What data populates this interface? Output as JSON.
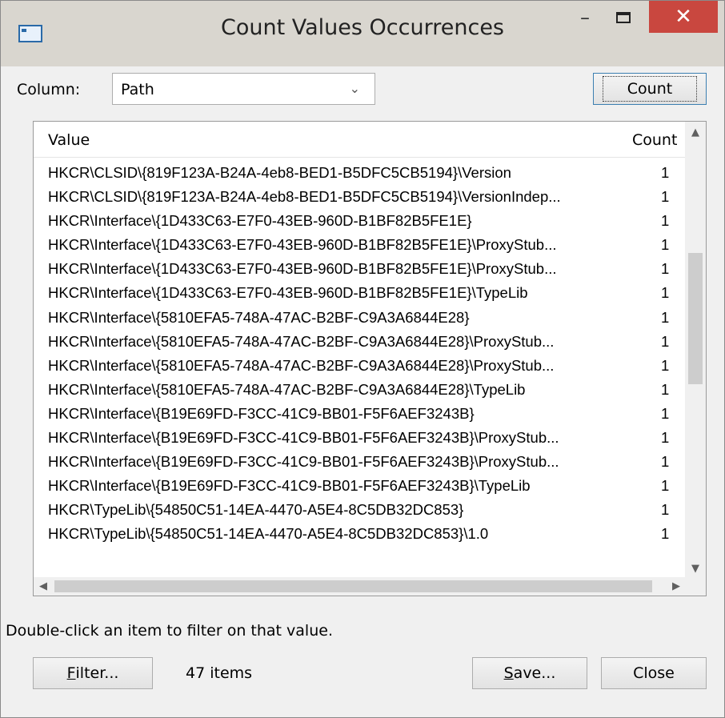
{
  "window": {
    "title": "Count Values Occurrences",
    "minimize_glyph": "–",
    "close_glyph": "✕"
  },
  "column": {
    "label": "Column:",
    "selected": "Path",
    "arrow": "⌄"
  },
  "count_button": "Count",
  "list": {
    "headers": {
      "value": "Value",
      "count": "Count"
    },
    "rows": [
      {
        "value": "HKCR\\CLSID\\{819F123A-B24A-4eb8-BED1-B5DFC5CB5194}\\Version",
        "count": "1"
      },
      {
        "value": "HKCR\\CLSID\\{819F123A-B24A-4eb8-BED1-B5DFC5CB5194}\\VersionIndep...",
        "count": "1"
      },
      {
        "value": "HKCR\\Interface\\{1D433C63-E7F0-43EB-960D-B1BF82B5FE1E}",
        "count": "1"
      },
      {
        "value": "HKCR\\Interface\\{1D433C63-E7F0-43EB-960D-B1BF82B5FE1E}\\ProxyStub...",
        "count": "1"
      },
      {
        "value": "HKCR\\Interface\\{1D433C63-E7F0-43EB-960D-B1BF82B5FE1E}\\ProxyStub...",
        "count": "1"
      },
      {
        "value": "HKCR\\Interface\\{1D433C63-E7F0-43EB-960D-B1BF82B5FE1E}\\TypeLib",
        "count": "1"
      },
      {
        "value": "HKCR\\Interface\\{5810EFA5-748A-47AC-B2BF-C9A3A6844E28}",
        "count": "1"
      },
      {
        "value": "HKCR\\Interface\\{5810EFA5-748A-47AC-B2BF-C9A3A6844E28}\\ProxyStub...",
        "count": "1"
      },
      {
        "value": "HKCR\\Interface\\{5810EFA5-748A-47AC-B2BF-C9A3A6844E28}\\ProxyStub...",
        "count": "1"
      },
      {
        "value": "HKCR\\Interface\\{5810EFA5-748A-47AC-B2BF-C9A3A6844E28}\\TypeLib",
        "count": "1"
      },
      {
        "value": "HKCR\\Interface\\{B19E69FD-F3CC-41C9-BB01-F5F6AEF3243B}",
        "count": "1"
      },
      {
        "value": "HKCR\\Interface\\{B19E69FD-F3CC-41C9-BB01-F5F6AEF3243B}\\ProxyStub...",
        "count": "1"
      },
      {
        "value": "HKCR\\Interface\\{B19E69FD-F3CC-41C9-BB01-F5F6AEF3243B}\\ProxyStub...",
        "count": "1"
      },
      {
        "value": "HKCR\\Interface\\{B19E69FD-F3CC-41C9-BB01-F5F6AEF3243B}\\TypeLib",
        "count": "1"
      },
      {
        "value": "HKCR\\TypeLib\\{54850C51-14EA-4470-A5E4-8C5DB32DC853}",
        "count": "1"
      },
      {
        "value": "HKCR\\TypeLib\\{54850C51-14EA-4470-A5E4-8C5DB32DC853}\\1.0",
        "count": "1"
      }
    ],
    "scroll_glyphs": {
      "up": "▲",
      "down": "▼",
      "left": "◀",
      "right": "▶"
    }
  },
  "hint": "Double-click an item to filter on that value.",
  "footer": {
    "filter_underlined": "F",
    "filter_rest": "ilter...",
    "items": "47 items",
    "save_underlined": "S",
    "save_rest": "ave...",
    "close": "Close"
  }
}
